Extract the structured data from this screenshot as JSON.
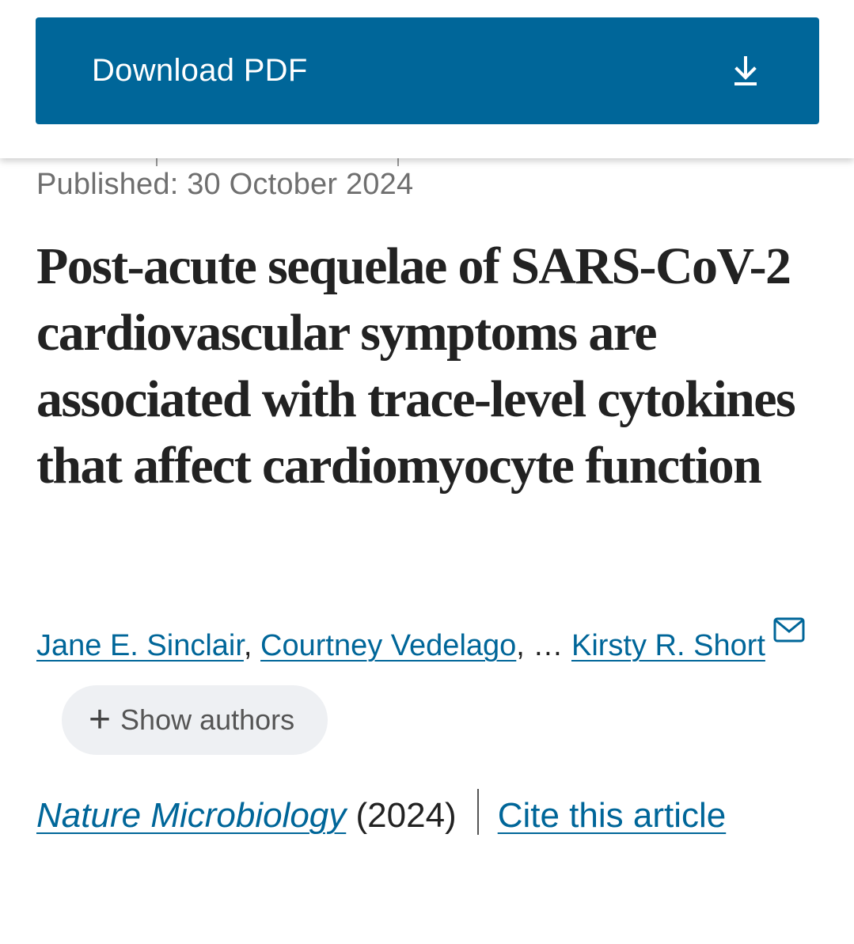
{
  "download": {
    "label": "Download PDF",
    "icon": "download-icon"
  },
  "article": {
    "published": "Published: 30 October 2024",
    "title": "Post-acute sequelae of SARS-CoV-2 cardiovascular symptoms are associated with trace-level cytokines that affect cardiomyocyte function",
    "authors": [
      "Jane E. Sinclair",
      "Courtney Vedelago",
      "Kirsty R. Short"
    ],
    "author_separator": ",",
    "ellipsis": "…",
    "show_authors_label": "Show authors",
    "journal": "Nature Microbiology",
    "year": "(2024)",
    "cite_label": "Cite this article"
  },
  "colors": {
    "accent": "#006699",
    "text": "#222222",
    "muted": "#6f6f6f",
    "pill": "#eef0f3"
  }
}
